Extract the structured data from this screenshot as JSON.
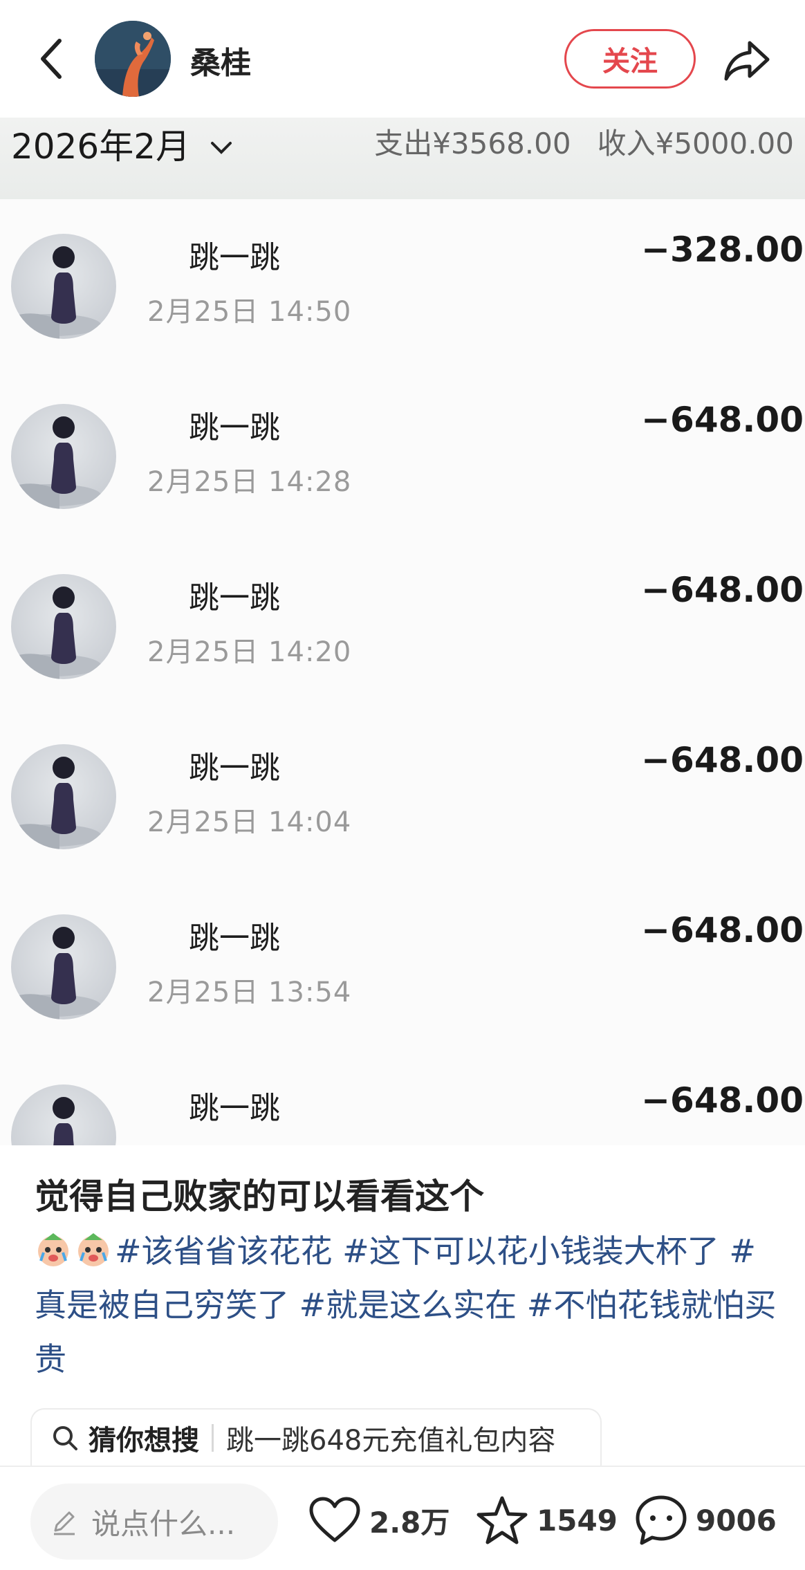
{
  "header": {
    "username": "桑桂",
    "follow_label": "关注"
  },
  "ledger": {
    "month": "2026年2月",
    "expense": "支出¥3568.00",
    "income": "收入¥5000.00",
    "transactions": [
      {
        "name": "跳一跳",
        "time": "2月25日 14:50",
        "amount": "−328.00"
      },
      {
        "name": "跳一跳",
        "time": "2月25日 14:28",
        "amount": "−648.00"
      },
      {
        "name": "跳一跳",
        "time": "2月25日 14:20",
        "amount": "−648.00"
      },
      {
        "name": "跳一跳",
        "time": "2月25日 14:04",
        "amount": "−648.00"
      },
      {
        "name": "跳一跳",
        "time": "2月25日 13:54",
        "amount": "−648.00"
      },
      {
        "name": "跳一跳",
        "time": "",
        "amount": "−648.00"
      }
    ]
  },
  "post": {
    "title": "觉得自己败家的可以看看这个",
    "tags": [
      "#该省省该花花",
      "#这下可以花小钱装大杯了",
      "#真是被自己穷笑了",
      "#就是这么实在",
      "#不怕花钱就怕买贵"
    ]
  },
  "search_suggestion": {
    "label": "猜你想搜",
    "query": "跳一跳648元充值礼包内容"
  },
  "bottom": {
    "comment_placeholder": "说点什么...",
    "likes": "2.8万",
    "favorites": "1549",
    "comments": "9006"
  },
  "colors": {
    "accent": "#e4474d",
    "tag": "#2d4f86"
  },
  "icons": [
    "back-icon",
    "share-icon",
    "chevron-down-icon",
    "search-icon",
    "pen-icon",
    "heart-icon",
    "star-icon",
    "comment-icon",
    "crying-emoji-icon"
  ]
}
